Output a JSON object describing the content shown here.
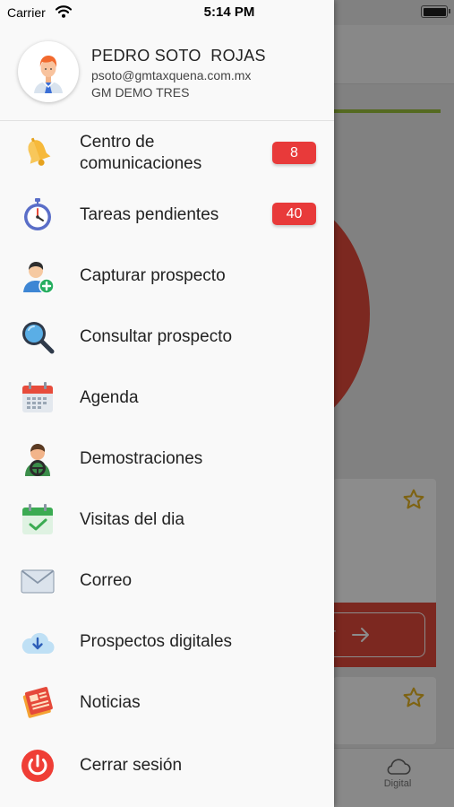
{
  "status_bar": {
    "carrier": "Carrier",
    "time": "5:14 PM"
  },
  "profile": {
    "name": "PEDRO SOTO  ROJAS",
    "email": "psoto@gmtaxquena.com.mx",
    "company": "GM DEMO TRES"
  },
  "menu": {
    "items": [
      {
        "label": "Centro de\ncomunicaciones",
        "badge": "8",
        "icon": "bell-icon"
      },
      {
        "label": "Tareas pendientes",
        "badge": "40",
        "icon": "stopwatch-icon"
      },
      {
        "label": "Capturar prospecto",
        "icon": "add-user-icon"
      },
      {
        "label": "Consultar prospecto",
        "icon": "magnifier-icon"
      },
      {
        "label": "Agenda",
        "icon": "calendar-icon"
      },
      {
        "label": "Demostraciones",
        "icon": "driver-icon"
      },
      {
        "label": "Visitas del dia",
        "icon": "calendar-check-icon"
      },
      {
        "label": "Correo",
        "icon": "envelope-icon"
      },
      {
        "label": "Prospectos digitales",
        "icon": "cloud-download-icon"
      },
      {
        "label": "Noticias",
        "icon": "newspaper-icon"
      },
      {
        "label": "Cerrar sesión",
        "icon": "power-icon"
      }
    ]
  },
  "background": {
    "button_text": "ir",
    "tab_digital_label": "Digital"
  },
  "colors": {
    "badge": "#e83a3a",
    "accent_red": "#e24a3b",
    "progress_green": "#9bc23c",
    "drawer_bg": "#f9f9f9"
  }
}
